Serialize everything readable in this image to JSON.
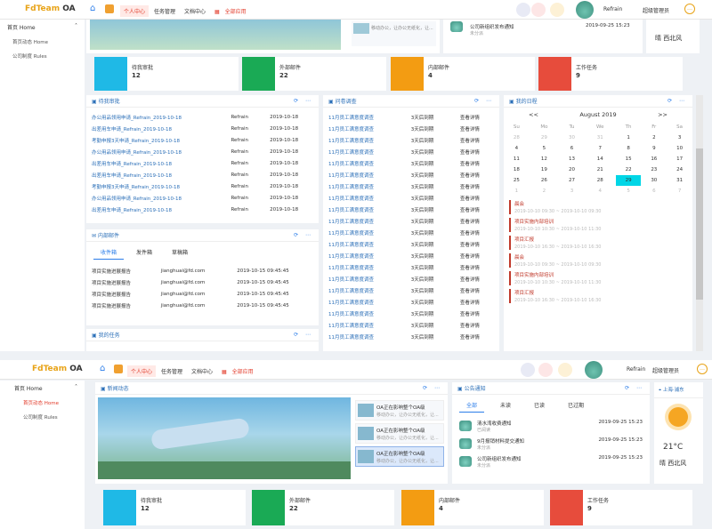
{
  "app": {
    "logo_main": "FdTeam",
    "logo_accent": " OA"
  },
  "nav": [
    "个人中心",
    "任务管理",
    "文档中心",
    "全部应用"
  ],
  "user": {
    "name": "Refrain",
    "role": "超级管理员"
  },
  "sidebar": {
    "group": "首页 Home",
    "items": [
      "首页动态 Home",
      "公司制度 Rules"
    ]
  },
  "stats": [
    {
      "label": "待我审批",
      "value": "12",
      "color": "#1fb9e6"
    },
    {
      "label": "外部邮件",
      "value": "22",
      "color": "#1aaa55"
    },
    {
      "label": "内部邮件",
      "value": "4",
      "color": "#f39c12"
    },
    {
      "label": "工作任务",
      "value": "9",
      "color": "#e74c3c"
    }
  ],
  "approvals": {
    "title": "待我审批",
    "rows": [
      {
        "name": "办公用品领用申请_Refrain_2019-10-18",
        "user": "Refrain",
        "date": "2019-10-18"
      },
      {
        "name": "出差用车申请_Refrain_2019-10-18",
        "user": "Refrain",
        "date": "2019-10-18"
      },
      {
        "name": "考勤申报3天申请_Refrain_2019-10-18",
        "user": "Refrain",
        "date": "2019-10-18"
      },
      {
        "name": "办公用品领用申请_Refrain_2019-10-18",
        "user": "Refrain",
        "date": "2019-10-18"
      },
      {
        "name": "出差用车申请_Refrain_2019-10-18",
        "user": "Refrain",
        "date": "2019-10-18"
      },
      {
        "name": "出差用车申请_Refrain_2019-10-18",
        "user": "Refrain",
        "date": "2019-10-18"
      },
      {
        "name": "考勤申报3天申请_Refrain_2019-10-18",
        "user": "Refrain",
        "date": "2019-10-18"
      },
      {
        "name": "办公用品领用申请_Refrain_2019-10-18",
        "user": "Refrain",
        "date": "2019-10-18"
      },
      {
        "name": "出差用车申请_Refrain_2019-10-18",
        "user": "Refrain",
        "date": "2019-10-18"
      }
    ]
  },
  "survey": {
    "title": "问卷调查",
    "rows": [
      {
        "name": "11月员工满意度调查",
        "deadline": "3天后到期",
        "action": "查看详情"
      },
      {
        "name": "11月员工满意度调查",
        "deadline": "3天后到期",
        "action": "查看详情"
      },
      {
        "name": "11月员工满意度调查",
        "deadline": "3天后到期",
        "action": "查看详情"
      },
      {
        "name": "11月员工满意度调查",
        "deadline": "3天后到期",
        "action": "查看详情"
      },
      {
        "name": "11月员工满意度调查",
        "deadline": "3天后到期",
        "action": "查看详情"
      },
      {
        "name": "11月员工满意度调查",
        "deadline": "3天后到期",
        "action": "查看详情"
      },
      {
        "name": "11月员工满意度调查",
        "deadline": "3天后到期",
        "action": "查看详情"
      },
      {
        "name": "11月员工满意度调查",
        "deadline": "3天后到期",
        "action": "查看详情"
      },
      {
        "name": "11月员工满意度调查",
        "deadline": "3天后到期",
        "action": "查看详情"
      },
      {
        "name": "11月员工满意度调查",
        "deadline": "3天后到期",
        "action": "查看详情"
      },
      {
        "name": "11月员工满意度调查",
        "deadline": "3天后到期",
        "action": "查看详情"
      },
      {
        "name": "11月员工满意度调查",
        "deadline": "3天后到期",
        "action": "查看详情"
      },
      {
        "name": "11月员工满意度调查",
        "deadline": "3天后到期",
        "action": "查看详情"
      },
      {
        "name": "11月员工满意度调查",
        "deadline": "3天后到期",
        "action": "查看详情"
      },
      {
        "name": "11月员工满意度调查",
        "deadline": "3天后到期",
        "action": "查看详情"
      },
      {
        "name": "11月员工满意度调查",
        "deadline": "3天后到期",
        "action": "查看详情"
      },
      {
        "name": "11月员工满意度调查",
        "deadline": "3天后到期",
        "action": "查看详情"
      },
      {
        "name": "11月员工满意度调查",
        "deadline": "3天后到期",
        "action": "查看详情"
      },
      {
        "name": "11月员工满意度调查",
        "deadline": "3天后到期",
        "action": "查看详情"
      },
      {
        "name": "11月员工满意度调查",
        "deadline": "3天后到期",
        "action": "查看详情"
      }
    ]
  },
  "schedule": {
    "title": "我的日程",
    "month": "August 2019",
    "prev": "<<",
    "next": ">>",
    "dow": [
      "Su",
      "Mo",
      "Tu",
      "We",
      "Th",
      "Fr",
      "Sa"
    ],
    "weeks": [
      [
        "28",
        "29",
        "30",
        "31",
        "1",
        "2",
        "3"
      ],
      [
        "4",
        "5",
        "6",
        "7",
        "8",
        "9",
        "10"
      ],
      [
        "11",
        "12",
        "13",
        "14",
        "15",
        "16",
        "17"
      ],
      [
        "18",
        "19",
        "20",
        "21",
        "22",
        "23",
        "24"
      ],
      [
        "25",
        "26",
        "27",
        "28",
        "29",
        "30",
        "31"
      ],
      [
        "1",
        "2",
        "3",
        "4",
        "5",
        "6",
        "7"
      ]
    ],
    "events": [
      {
        "title": "晨会",
        "time": "2019-10-10 09:30 ~ 2019-10-10 09:30"
      },
      {
        "title": "项目实施内部培训",
        "time": "2019-10-10 10:30 ~ 2019-10-10 11:30"
      },
      {
        "title": "项目汇报",
        "time": "2019-10-10 16:30 ~ 2019-10-10 16:30"
      },
      {
        "title": "晨会",
        "time": "2019-10-10 09:30 ~ 2019-10-10 09:30"
      },
      {
        "title": "项目实施内部培训",
        "time": "2019-10-10 10:30 ~ 2019-10-10 11:30"
      },
      {
        "title": "项目汇报",
        "time": "2019-10-10 16:30 ~ 2019-10-10 16:30"
      }
    ]
  },
  "inbox": {
    "title": "内部邮件",
    "tabs": [
      "收件箱",
      "发件箱",
      "草稿箱"
    ],
    "rows": [
      {
        "subject": "项目实施进展报告",
        "from": "jianghuai@fd.com",
        "time": "2019-10-15 09:45:45"
      },
      {
        "subject": "项目实施进展报告",
        "from": "jianghuai@fd.com",
        "time": "2019-10-15 09:45:45"
      },
      {
        "subject": "项目实施进展报告",
        "from": "jianghuai@fd.com",
        "time": "2019-10-15 09:45:45"
      },
      {
        "subject": "项目实施进展报告",
        "from": "jianghuai@fd.com",
        "time": "2019-10-15 09:45:45"
      }
    ]
  },
  "tasks": {
    "title": "我的任务"
  },
  "news": {
    "title": "新闻动态",
    "items": [
      {
        "title": "OA正在影响整个OA级",
        "desc": "移动办公，让办公无纸化，让..."
      },
      {
        "title": "OA正在影响整个OA级",
        "desc": "移动办公，让办公无纸化，让..."
      },
      {
        "title": "OA正在影响整个OA级",
        "desc": "移动办公，让办公无纸化，让..."
      }
    ]
  },
  "notice": {
    "title": "公告通知",
    "tabs": [
      "全部",
      "未读",
      "已读",
      "已过期"
    ],
    "items": [
      {
        "title": "清水湾收费通知",
        "status": "已阅读",
        "date": "2019-09-25 15:23"
      },
      {
        "title": "9月报销材料提交通知",
        "status": "未分派",
        "date": "2019-09-25 15:23"
      },
      {
        "title": "公司新组织发布通知",
        "status": "未分派",
        "date": "2019-09-25 15:23"
      }
    ]
  },
  "weather": {
    "city": "上海·浦东",
    "temp": "21°C",
    "desc": "晴 西北风"
  }
}
